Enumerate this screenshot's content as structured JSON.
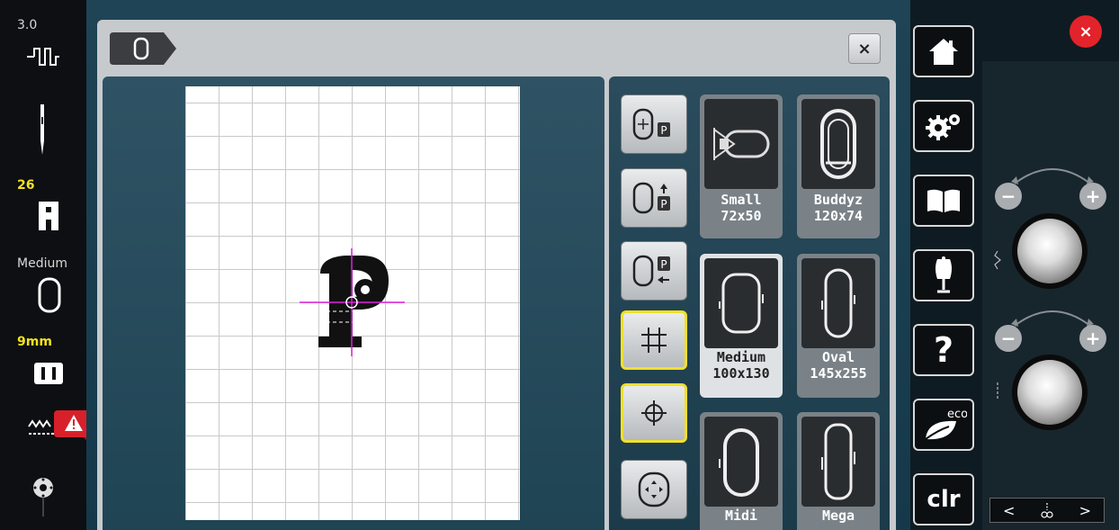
{
  "left_status": {
    "version": "3.0",
    "needle_number": "26",
    "hoop_label": "Medium",
    "stitch_width": "9mm"
  },
  "dialog": {
    "close_label": "×"
  },
  "hoops": [
    {
      "name": "Small",
      "size": "72x50"
    },
    {
      "name": "Buddyz",
      "size": "120x74"
    },
    {
      "name": "Medium",
      "size": "100x130"
    },
    {
      "name": "Oval",
      "size": "145x255"
    },
    {
      "name": "Midi",
      "size": ""
    },
    {
      "name": "Mega",
      "size": ""
    }
  ],
  "sidebar": {
    "eco_label": "eco",
    "clr_label": "clr",
    "help_label": "?"
  },
  "knobs": {
    "minus": "−",
    "plus": "+"
  },
  "bottom_nav": {
    "prev": "<",
    "next": ">"
  },
  "window_close": "×",
  "colors": {
    "accent_yellow": "#f2e02a",
    "close_red": "#e2232b",
    "warning_red": "#d8202a"
  }
}
